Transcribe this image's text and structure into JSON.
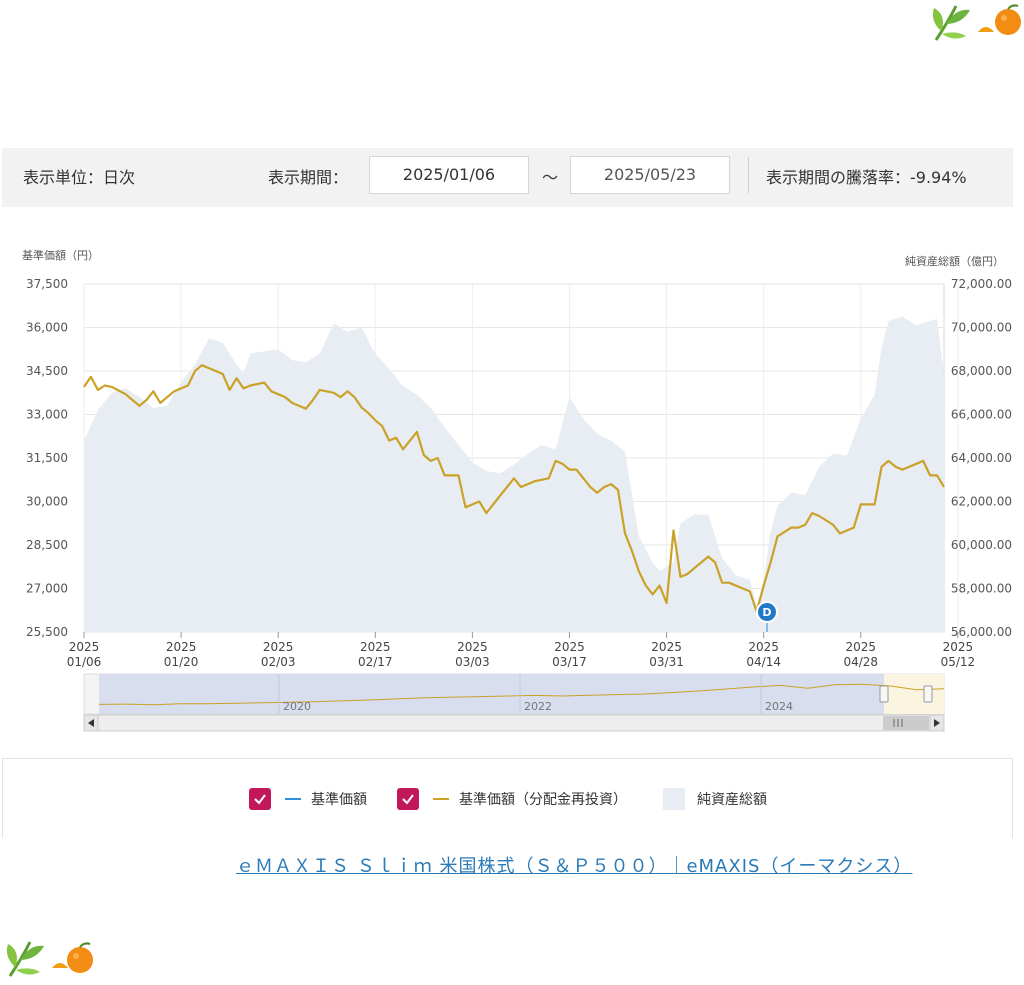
{
  "controls": {
    "unit_label": "表示単位：日次",
    "period_label": "表示期間：",
    "start_date": "2025/01/06",
    "tilde": "～",
    "end_date": "2025/05/23",
    "change_label": "表示期間の騰落率：-9.94%"
  },
  "chart_data": {
    "type": "line",
    "left_axis_title": "基準価額（円）",
    "right_axis_title": "純資産総額（億円）",
    "ylim_left": [
      25500,
      37500
    ],
    "ylim_right": [
      56000,
      72000
    ],
    "left_ticks": [
      "37,500",
      "36,000",
      "34,500",
      "33,000",
      "31,500",
      "30,000",
      "28,500",
      "27,000",
      "25,500"
    ],
    "right_ticks": [
      "72,000.00",
      "70,000.00",
      "68,000.00",
      "66,000.00",
      "64,000.00",
      "62,000.00",
      "60,000.00",
      "58,000.00",
      "56,000.00"
    ],
    "x_ticks": [
      {
        "year": "2025",
        "date": "01/06"
      },
      {
        "year": "2025",
        "date": "01/20"
      },
      {
        "year": "2025",
        "date": "02/03"
      },
      {
        "year": "2025",
        "date": "02/17"
      },
      {
        "year": "2025",
        "date": "03/03"
      },
      {
        "year": "2025",
        "date": "03/17"
      },
      {
        "year": "2025",
        "date": "03/31"
      },
      {
        "year": "2025",
        "date": "04/14"
      },
      {
        "year": "2025",
        "date": "04/28"
      },
      {
        "year": "2025",
        "date": "05/12"
      }
    ],
    "series": [
      {
        "name": "基準価額（分配金再投資）",
        "color": "#c9a227",
        "points": [
          [
            0,
            33950
          ],
          [
            1,
            34300
          ],
          [
            2,
            33850
          ],
          [
            3,
            34000
          ],
          [
            4,
            33950
          ],
          [
            6,
            33700
          ],
          [
            7,
            33500
          ],
          [
            8,
            33300
          ],
          [
            9,
            33500
          ],
          [
            10,
            33800
          ],
          [
            11,
            33400
          ],
          [
            13,
            33800
          ],
          [
            14,
            33900
          ],
          [
            15,
            34000
          ],
          [
            16,
            34500
          ],
          [
            17,
            34700
          ],
          [
            18,
            34600
          ],
          [
            19,
            34500
          ],
          [
            20,
            34400
          ],
          [
            21,
            33850
          ],
          [
            22,
            34250
          ],
          [
            23,
            33900
          ],
          [
            24,
            34000
          ],
          [
            26,
            34100
          ],
          [
            27,
            33800
          ],
          [
            28,
            33700
          ],
          [
            29,
            33600
          ],
          [
            30,
            33400
          ],
          [
            32,
            33200
          ],
          [
            33,
            33500
          ],
          [
            34,
            33850
          ],
          [
            36,
            33750
          ],
          [
            37,
            33600
          ],
          [
            38,
            33800
          ],
          [
            39,
            33600
          ],
          [
            40,
            33250
          ],
          [
            41,
            33050
          ],
          [
            42,
            32800
          ],
          [
            43,
            32600
          ],
          [
            44,
            32100
          ],
          [
            45,
            32200
          ],
          [
            46,
            31800
          ],
          [
            48,
            32400
          ],
          [
            49,
            31600
          ],
          [
            50,
            31400
          ],
          [
            51,
            31500
          ],
          [
            52,
            30900
          ],
          [
            54,
            30900
          ],
          [
            55,
            29800
          ],
          [
            56,
            29900
          ],
          [
            57,
            30000
          ],
          [
            58,
            29600
          ],
          [
            60,
            30200
          ],
          [
            61,
            30500
          ],
          [
            62,
            30800
          ],
          [
            63,
            30500
          ],
          [
            65,
            30700
          ],
          [
            67,
            30800
          ],
          [
            68,
            31400
          ],
          [
            69,
            31300
          ],
          [
            70,
            31100
          ],
          [
            71,
            31100
          ],
          [
            72,
            30800
          ],
          [
            73,
            30500
          ],
          [
            74,
            30300
          ],
          [
            75,
            30500
          ],
          [
            76,
            30600
          ],
          [
            77,
            30400
          ],
          [
            78,
            28900
          ],
          [
            79,
            28300
          ],
          [
            80,
            27600
          ],
          [
            81,
            27100
          ],
          [
            82,
            26800
          ],
          [
            83,
            27100
          ],
          [
            84,
            26500
          ],
          [
            85,
            29000
          ],
          [
            86,
            27400
          ],
          [
            87,
            27500
          ],
          [
            88,
            27700
          ],
          [
            90,
            28100
          ],
          [
            91,
            27900
          ],
          [
            92,
            27200
          ],
          [
            93,
            27200
          ],
          [
            94,
            27100
          ],
          [
            95,
            27000
          ],
          [
            96,
            26900
          ],
          [
            97,
            26200
          ],
          [
            98,
            27100
          ],
          [
            99,
            27900
          ],
          [
            100,
            28800
          ],
          [
            102,
            29100
          ],
          [
            103,
            29100
          ],
          [
            104,
            29200
          ],
          [
            105,
            29600
          ],
          [
            106,
            29500
          ],
          [
            108,
            29200
          ],
          [
            109,
            28900
          ],
          [
            110,
            29000
          ],
          [
            111,
            29100
          ],
          [
            112,
            29900
          ],
          [
            113,
            29900
          ],
          [
            114,
            29900
          ],
          [
            115,
            31200
          ],
          [
            116,
            31400
          ],
          [
            117,
            31200
          ],
          [
            118,
            31100
          ],
          [
            120,
            31300
          ],
          [
            121,
            31400
          ],
          [
            122,
            30900
          ],
          [
            123,
            30900
          ],
          [
            124,
            30500
          ]
        ]
      },
      {
        "name": "純資産総額",
        "color": "#e8ecf3",
        "points": [
          [
            0,
            64800
          ],
          [
            2,
            66200
          ],
          [
            4,
            67000
          ],
          [
            6,
            67200
          ],
          [
            8,
            66800
          ],
          [
            10,
            66300
          ],
          [
            12,
            66400
          ],
          [
            14,
            67500
          ],
          [
            16,
            68300
          ],
          [
            18,
            69500
          ],
          [
            20,
            69300
          ],
          [
            21,
            68800
          ],
          [
            22,
            68300
          ],
          [
            23,
            67900
          ],
          [
            24,
            68800
          ],
          [
            26,
            68900
          ],
          [
            28,
            69000
          ],
          [
            30,
            68500
          ],
          [
            32,
            68400
          ],
          [
            34,
            68800
          ],
          [
            36,
            70200
          ],
          [
            38,
            69800
          ],
          [
            40,
            70000
          ],
          [
            42,
            68800
          ],
          [
            44,
            68100
          ],
          [
            46,
            67300
          ],
          [
            48,
            66900
          ],
          [
            50,
            66300
          ],
          [
            52,
            65400
          ],
          [
            54,
            64600
          ],
          [
            56,
            63800
          ],
          [
            58,
            63400
          ],
          [
            60,
            63300
          ],
          [
            62,
            63700
          ],
          [
            64,
            64200
          ],
          [
            66,
            64600
          ],
          [
            68,
            64400
          ],
          [
            70,
            66800
          ],
          [
            72,
            65800
          ],
          [
            74,
            65100
          ],
          [
            76,
            64800
          ],
          [
            78,
            64300
          ],
          [
            80,
            60400
          ],
          [
            82,
            59200
          ],
          [
            83,
            58800
          ],
          [
            84,
            59000
          ],
          [
            85,
            59200
          ],
          [
            86,
            61000
          ],
          [
            88,
            61400
          ],
          [
            90,
            61400
          ],
          [
            92,
            59400
          ],
          [
            94,
            58600
          ],
          [
            96,
            58400
          ],
          [
            97,
            57200
          ],
          [
            98,
            58400
          ],
          [
            99,
            60600
          ],
          [
            100,
            61800
          ],
          [
            102,
            62400
          ],
          [
            104,
            62300
          ],
          [
            106,
            63600
          ],
          [
            108,
            64200
          ],
          [
            110,
            64100
          ],
          [
            112,
            65800
          ],
          [
            114,
            66900
          ],
          [
            115,
            69100
          ],
          [
            116,
            70300
          ],
          [
            118,
            70500
          ],
          [
            120,
            70100
          ],
          [
            122,
            70300
          ],
          [
            123,
            70400
          ],
          [
            124,
            67800
          ]
        ]
      },
      {
        "name": "基準価額",
        "color": "#2d8fd8",
        "points": []
      }
    ],
    "navigator": {
      "year_labels": [
        "2020",
        "2022",
        "2024"
      ],
      "values": [
        0.2,
        0.21,
        0.19,
        0.22,
        0.22,
        0.24,
        0.26,
        0.28,
        0.3,
        0.33,
        0.36,
        0.4,
        0.44,
        0.46,
        0.48,
        0.5,
        0.52,
        0.5,
        0.53,
        0.55,
        0.57,
        0.62,
        0.68,
        0.75,
        0.82,
        0.88,
        0.78,
        0.9,
        0.92,
        0.86,
        0.72,
        0.76
      ]
    },
    "marker": {
      "label": "D"
    }
  },
  "legend": {
    "item1": "基準価額",
    "item2": "基準価額（分配金再投資）",
    "item3": "純資産総額"
  },
  "footer_link": "ｅＭＡＸＩＳ Ｓｌｉｍ 米国株式（Ｓ＆Ｐ５００）｜eMAXIS（イーマクシス）",
  "colors": {
    "accent_checkbox": "#c2185b",
    "nav_line": "#2d8fd8",
    "reinvest_line": "#c9a227",
    "assets_area": "#e8ecf3"
  }
}
